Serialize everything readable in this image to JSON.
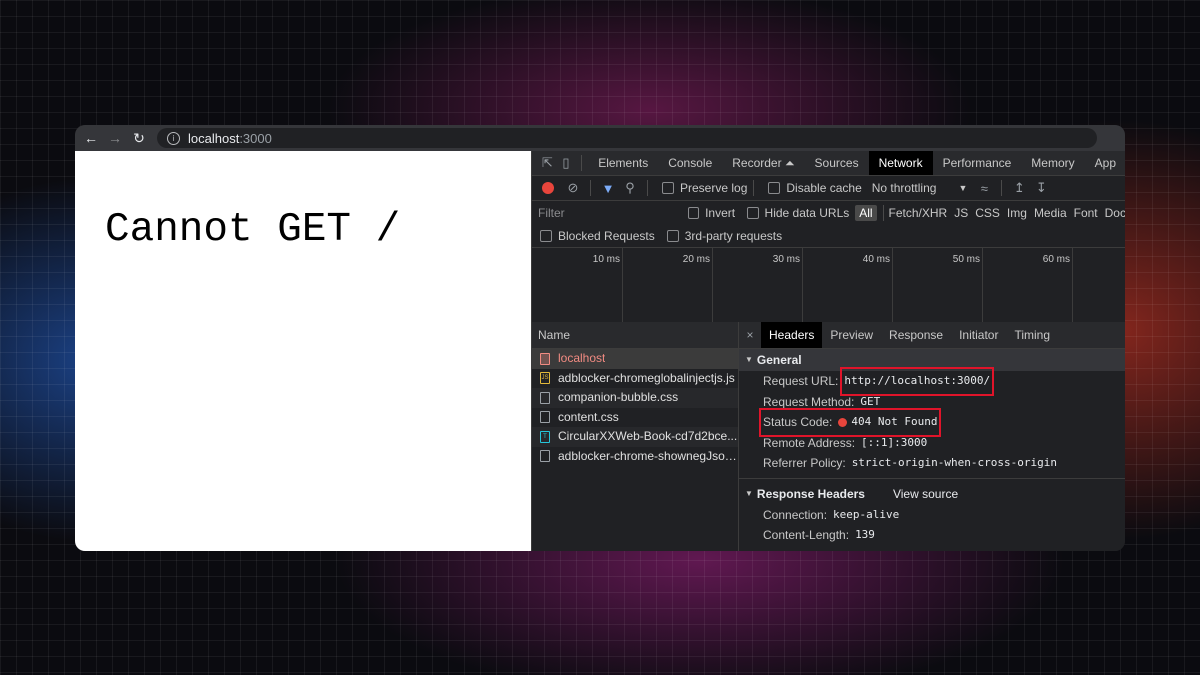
{
  "browser": {
    "url_host": "localhost",
    "url_port": ":3000",
    "info_glyph": "i"
  },
  "page": {
    "message": "Cannot GET /"
  },
  "devtools": {
    "tabs": [
      "Elements",
      "Console",
      "Recorder ⏶",
      "Sources",
      "Network",
      "Performance",
      "Memory",
      "App"
    ],
    "active_tab": "Network",
    "toolbar": {
      "preserve_log": "Preserve log",
      "disable_cache": "Disable cache",
      "throttling": "No throttling"
    },
    "filter": {
      "placeholder": "Filter",
      "invert": "Invert",
      "hide_data_urls": "Hide data URLs",
      "types": [
        "All",
        "Fetch/XHR",
        "JS",
        "CSS",
        "Img",
        "Media",
        "Font",
        "Doc"
      ],
      "blocked_requests": "Blocked Requests",
      "third_party": "3rd-party requests"
    },
    "timeline_ticks": [
      "10 ms",
      "20 ms",
      "30 ms",
      "40 ms",
      "50 ms",
      "60 ms"
    ],
    "name_header": "Name",
    "requests": [
      {
        "name": "localhost",
        "type": "doc"
      },
      {
        "name": "adblocker-chromeglobalinjectjs.js",
        "type": "js"
      },
      {
        "name": "companion-bubble.css",
        "type": "css"
      },
      {
        "name": "content.css",
        "type": "css"
      },
      {
        "name": "CircularXXWeb-Book-cd7d2bce...",
        "type": "font"
      },
      {
        "name": "adblocker-chrome-shownegJson...",
        "type": "other"
      }
    ],
    "details": {
      "tabs": [
        "Headers",
        "Preview",
        "Response",
        "Initiator",
        "Timing"
      ],
      "active_tab": "Headers",
      "general": {
        "title": "General",
        "request_url_label": "Request URL:",
        "request_url": "http://localhost:3000/",
        "request_method_label": "Request Method:",
        "request_method": "GET",
        "status_code_label": "Status Code:",
        "status_code": "404 Not Found",
        "remote_address_label": "Remote Address:",
        "remote_address": "[::1]:3000",
        "referrer_policy_label": "Referrer Policy:",
        "referrer_policy": "strict-origin-when-cross-origin"
      },
      "response_headers": {
        "title": "Response Headers",
        "view_source": "View source",
        "connection_label": "Connection:",
        "connection": "keep-alive",
        "content_length_label": "Content-Length:",
        "content_length": "139"
      }
    }
  },
  "colors": {
    "status_error": "#e8453c",
    "highlight_box": "#e0142a",
    "selected_request": "#f28b82"
  }
}
